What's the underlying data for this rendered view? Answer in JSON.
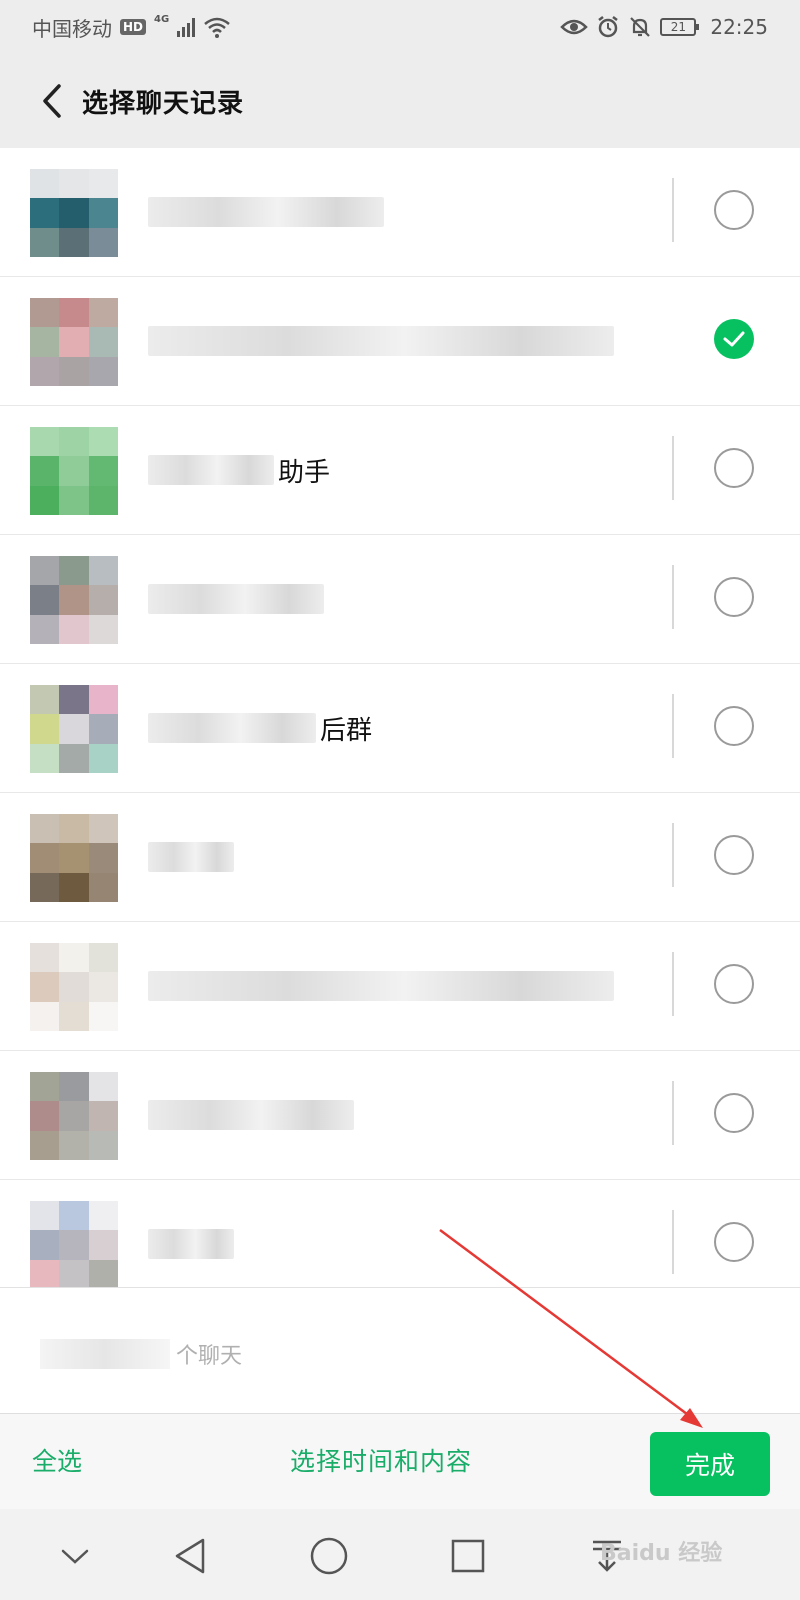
{
  "status_bar": {
    "carrier": "中国移动",
    "hd": "HD",
    "network": "4G",
    "battery": "21",
    "time": "22:25"
  },
  "header": {
    "title": "选择聊天记录"
  },
  "chats": [
    {
      "visible_name": "",
      "checked": false
    },
    {
      "visible_name": "",
      "checked": true
    },
    {
      "visible_name": "助手",
      "checked": false
    },
    {
      "visible_name": "",
      "checked": false
    },
    {
      "visible_name": "后群",
      "checked": false
    },
    {
      "visible_name": "",
      "checked": false
    },
    {
      "visible_name": "",
      "checked": false
    },
    {
      "visible_name": "",
      "checked": false
    },
    {
      "visible_name": "",
      "checked": false
    }
  ],
  "hint": {
    "suffix": "个聊天"
  },
  "bottom_bar": {
    "select_all_label": "全选",
    "select_time_label": "选择时间和内容",
    "done_label": "完成"
  },
  "watermark": "Baidu 经验",
  "colors": {
    "accent": "#07c160",
    "link": "#1aad6a",
    "background_header": "#ededed",
    "annotation_arrow": "#e53935"
  },
  "icons": {
    "back": "chevron-left-icon",
    "checked": "checkmark-icon",
    "nav": [
      "chevron-down-icon",
      "back-triangle-icon",
      "home-circle-icon",
      "recents-square-icon",
      "download-tray-icon"
    ]
  }
}
